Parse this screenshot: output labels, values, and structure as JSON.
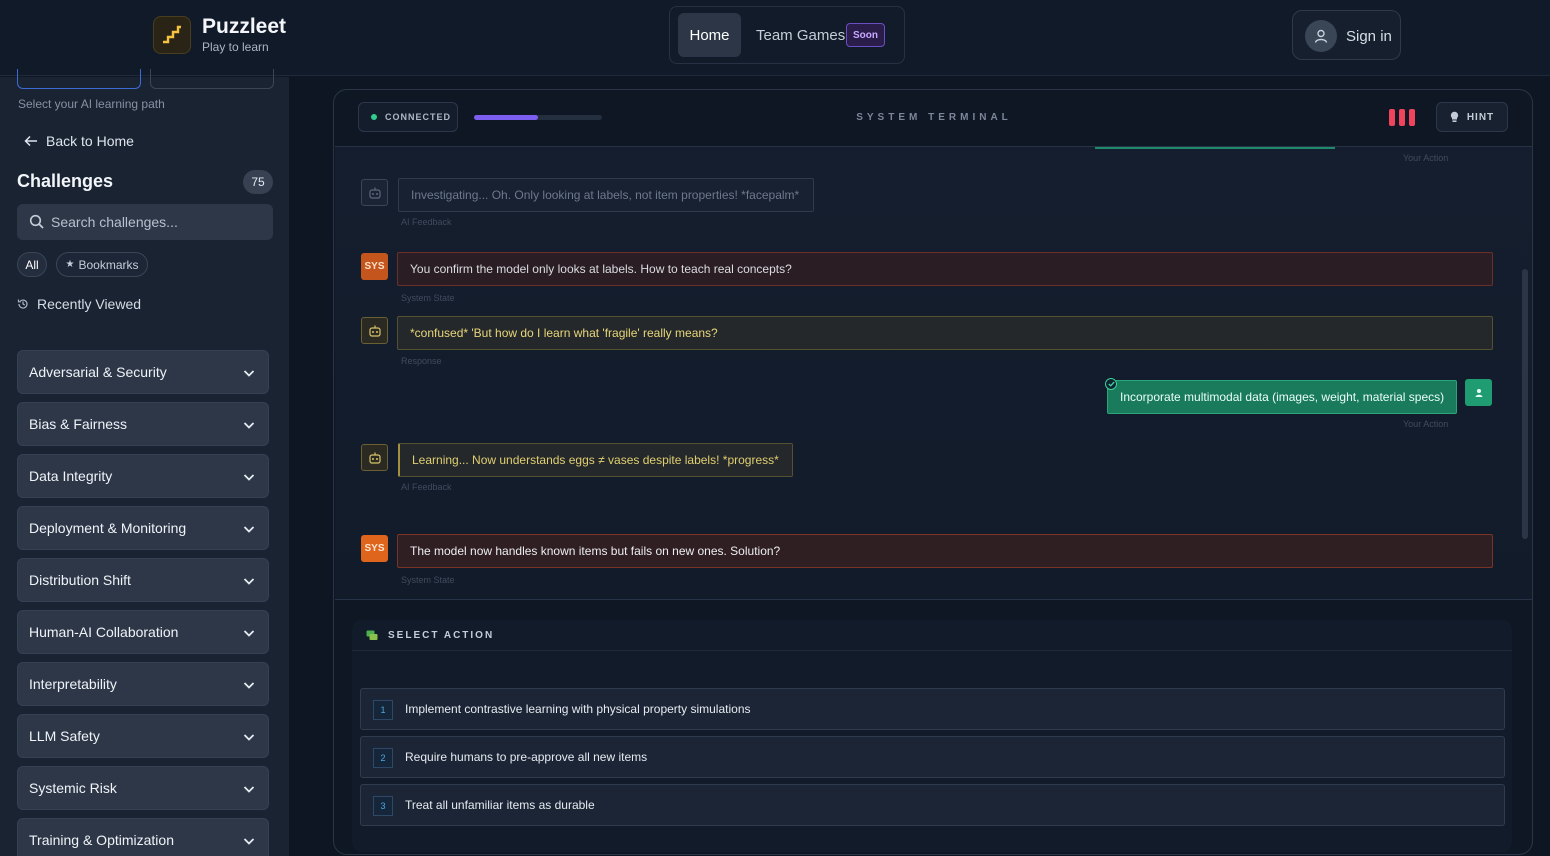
{
  "brand": {
    "title": "Puzzleet",
    "subtitle": "Play to learn"
  },
  "nav": {
    "home": "Home",
    "team_games": "Team Games",
    "soon_badge": "Soon"
  },
  "auth": {
    "sign_in": "Sign in"
  },
  "sidebar": {
    "path_hint": "Select your AI learning path",
    "back": "Back to Home",
    "challenges_title": "Challenges",
    "challenges_count": "75",
    "search_placeholder": "Search challenges...",
    "filter_all": "All",
    "filter_bookmarks": "Bookmarks",
    "recently_viewed": "Recently Viewed",
    "categories": [
      "Adversarial & Security",
      "Bias & Fairness",
      "Data Integrity",
      "Deployment & Monitoring",
      "Distribution Shift",
      "Human-AI Collaboration",
      "Interpretability",
      "LLM Safety",
      "Systemic Risk",
      "Training & Optimization"
    ]
  },
  "terminal": {
    "status": "CONNECTED",
    "progress_fraction": 0.5,
    "title": "SYSTEM TERMINAL",
    "lives_remaining": 3,
    "hint": "HINT",
    "colors": {
      "accent": "#7c5ef0",
      "life": "#f0445c",
      "connected": "#2ecf8e"
    }
  },
  "chat": {
    "top_caption": "Your Action",
    "messages": [
      {
        "kind": "ai",
        "text": "Investigating... Oh. Only looking at labels, not item properties! *facepalm*",
        "caption": "AI Feedback"
      },
      {
        "kind": "sys",
        "avatar": "SYS",
        "text": "You confirm the model only looks at labels. How to teach real concepts?",
        "caption": "System State"
      },
      {
        "kind": "response",
        "text": "*confused* 'But how do I learn what 'fragile' really means?",
        "caption": "Response"
      },
      {
        "kind": "user",
        "text": "Incorporate multimodal data (images, weight, material specs)",
        "caption": "Your Action"
      },
      {
        "kind": "feedback",
        "text": "Learning... Now understands eggs ≠ vases despite labels! *progress*",
        "caption": "AI Feedback"
      },
      {
        "kind": "sys",
        "avatar": "SYS",
        "text": "The model now handles known items but fails on new ones. Solution?",
        "caption": "System State"
      }
    ]
  },
  "actions": {
    "title": "SELECT ACTION",
    "options": [
      {
        "num": "1",
        "label": "Implement contrastive learning with physical property simulations"
      },
      {
        "num": "2",
        "label": "Require humans to pre-approve all new items"
      },
      {
        "num": "3",
        "label": "Treat all unfamiliar items as durable"
      }
    ]
  }
}
